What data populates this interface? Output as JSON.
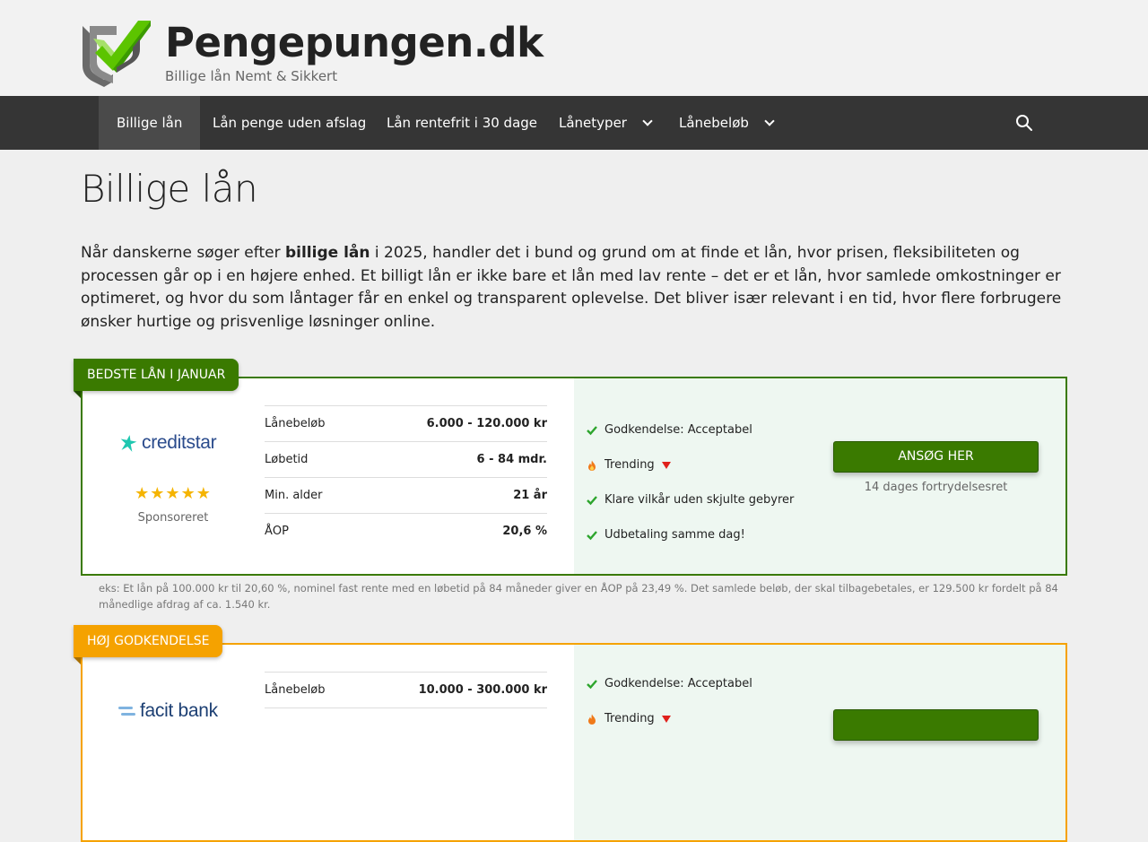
{
  "site": {
    "title": "Pengepungen.dk",
    "tagline": "Billige lån Nemt & Sikkert"
  },
  "nav": {
    "items": [
      {
        "label": "Billige lån",
        "active": true,
        "dropdown": false
      },
      {
        "label": "Lån penge uden afslag",
        "active": false,
        "dropdown": false
      },
      {
        "label": "Lån rentefrit i 30 dage",
        "active": false,
        "dropdown": false
      },
      {
        "label": "Lånetyper",
        "active": false,
        "dropdown": true
      },
      {
        "label": "Lånebeløb",
        "active": false,
        "dropdown": true
      }
    ],
    "search_icon": "search-icon"
  },
  "page": {
    "title": "Billige lån",
    "intro_before": "Når danskerne søger efter ",
    "intro_bold": "billige lån",
    "intro_after": " i 2025, handler det i bund og grund om at finde et lån, hvor prisen, fleksibiliteten og processen går op i en højere enhed. Et billigt lån er ikke bare et lån med lav rente – det er et lån, hvor samlede omkostninger er optimeret, og hvor du som låntager får en enkel og transparent oplevelse. Det bliver især relevant i en tid, hvor flere forbrugere ønsker hurtige og prisvenlige løsninger online."
  },
  "offers": [
    {
      "ribbon": "BEDSTE LÅN I JANUAR",
      "ribbon_color": "#3a7a00",
      "brand": "creditstar",
      "stars": "★★★★★",
      "sponsored": "Sponsoreret",
      "specs": [
        {
          "label": "Lånebeløb",
          "value": "6.000 - 120.000 kr"
        },
        {
          "label": "Løbetid",
          "value": "6 - 84 mdr."
        },
        {
          "label": "Min. alder",
          "value": "21 år"
        },
        {
          "label": "ÅOP",
          "value": "20,6 %"
        }
      ],
      "features": [
        {
          "text": "Godkendelse: Acceptabel",
          "icon": "check-icon"
        },
        {
          "text": "Trending",
          "icon": "fire-icon"
        },
        {
          "text": "Klare vilkår uden skjulte gebyrer",
          "icon": "check-icon"
        },
        {
          "text": "Udbetaling samme dag!",
          "icon": "check-icon"
        }
      ],
      "button": "ANSØG HER",
      "button_sub": "14 dages fortrydelsesret",
      "disclaimer": "eks: Et lån på 100.000 kr til 20,60 %, nominel fast rente med en løbetid på 84 måneder giver en ÅOP på 23,49 %. Det samlede beløb, der skal tilbagebetales, er 129.500 kr fordelt på 84 månedlige afdrag af ca. 1.540 kr."
    },
    {
      "ribbon": "HØJ GODKENDELSE",
      "ribbon_color": "#f5a200",
      "brand": "facit bank",
      "specs": [
        {
          "label": "Lånebeløb",
          "value": "10.000 - 300.000 kr"
        }
      ],
      "features": [
        {
          "text": "Godkendelse: Acceptabel",
          "icon": "check-icon"
        },
        {
          "text": "Trending",
          "icon": "fire-icon"
        }
      ]
    }
  ]
}
